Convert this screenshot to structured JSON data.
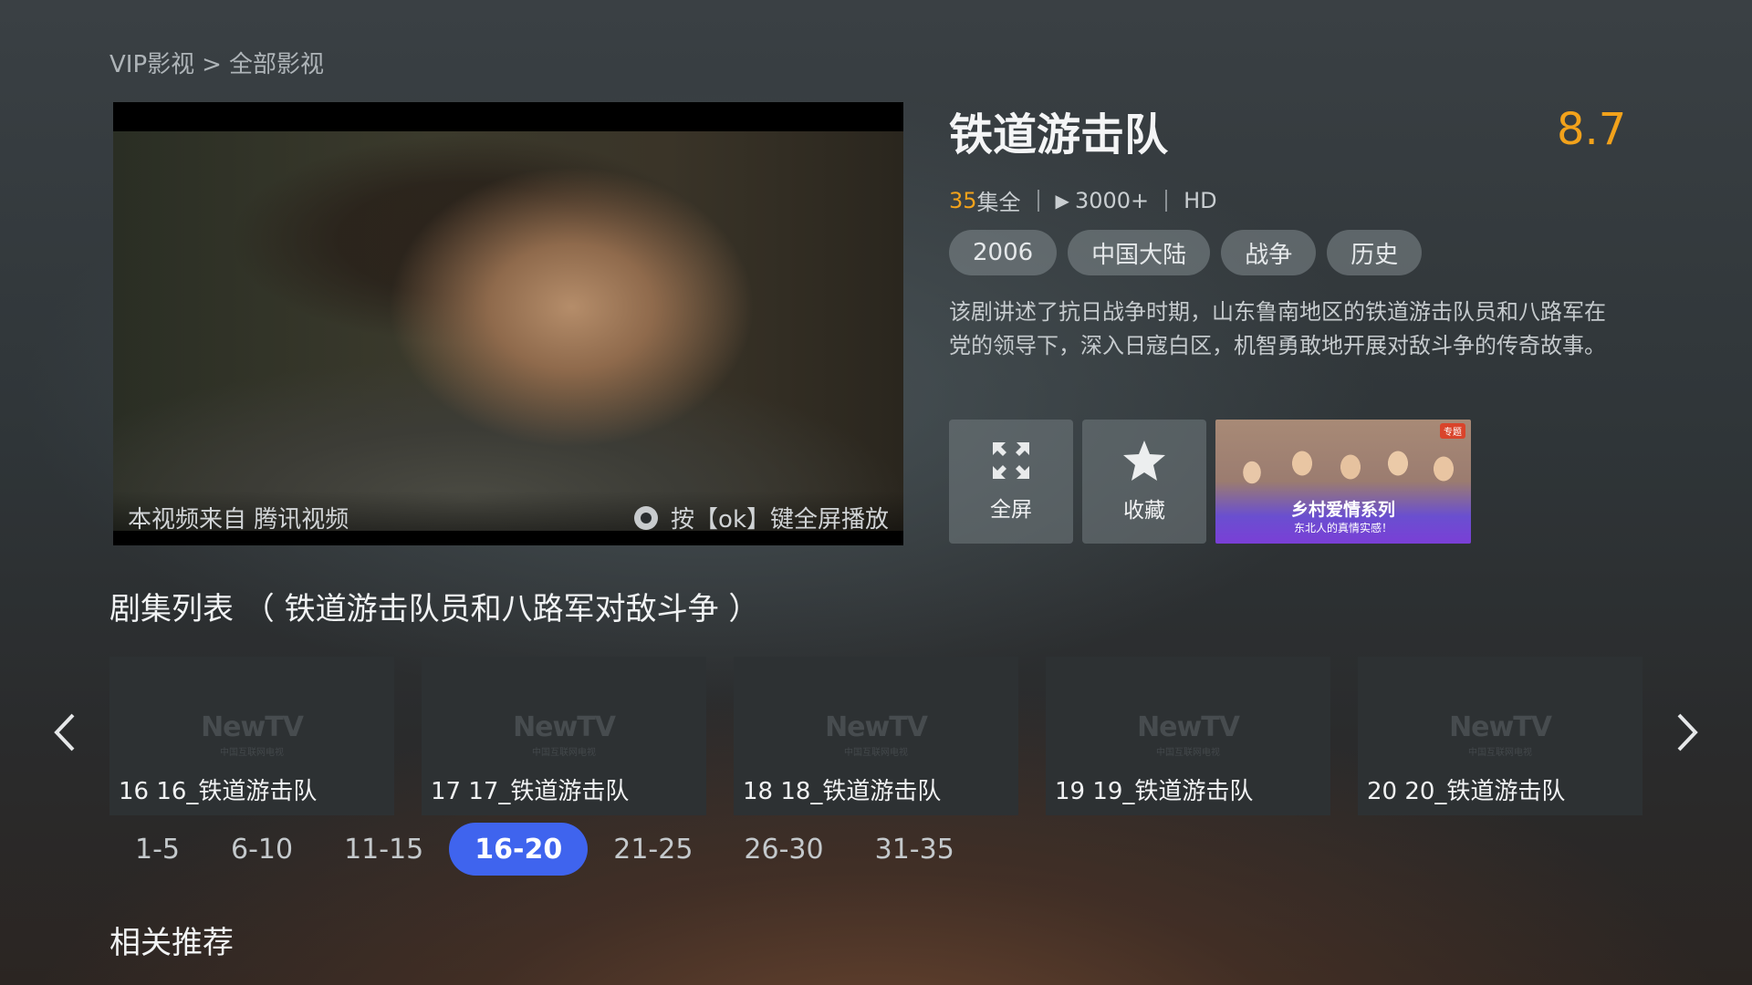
{
  "breadcrumb": {
    "root": "VIP影视",
    "sep": ">",
    "current": "全部影视"
  },
  "player": {
    "source_text": "本视频来自 腾讯视频",
    "hint_text": "按【ok】键全屏播放",
    "hint_icon": "ok-icon"
  },
  "show": {
    "title": "铁道游击队",
    "rating": "8.7",
    "episode_count": "35",
    "episode_suffix": "集全",
    "plays": "3000+",
    "quality": "HD",
    "tags": [
      "2006",
      "中国大陆",
      "战争",
      "历史"
    ],
    "synopsis": "该剧讲述了抗日战争时期，山东鲁南地区的铁道游击队员和八路军在党的领导下，深入日寇白区，机智勇敢地开展对敌斗争的传奇故事。"
  },
  "actions": {
    "fullscreen_label": "全屏",
    "favorite_label": "收藏"
  },
  "promo": {
    "title": "乡村爱情系列",
    "subtitle": "东北人的真情实感！",
    "badge": "专题"
  },
  "episodes": {
    "heading": "剧集列表 （ 铁道游击队员和八路军对敌斗争 ）",
    "logo_text": "NewTV",
    "logo_sub": "中国互联网电视",
    "items": [
      {
        "label": "16 16_铁道游击队"
      },
      {
        "label": "17 17_铁道游击队"
      },
      {
        "label": "18 18_铁道游击队"
      },
      {
        "label": "19 19_铁道游击队"
      },
      {
        "label": "20 20_铁道游击队"
      }
    ],
    "ranges": [
      "1-5",
      "6-10",
      "11-15",
      "16-20",
      "21-25",
      "26-30",
      "31-35"
    ],
    "active_range": "16-20"
  },
  "related": {
    "heading": "相关推荐"
  },
  "colors": {
    "accent": "#3f64ee",
    "rating": "#f2a21b"
  }
}
